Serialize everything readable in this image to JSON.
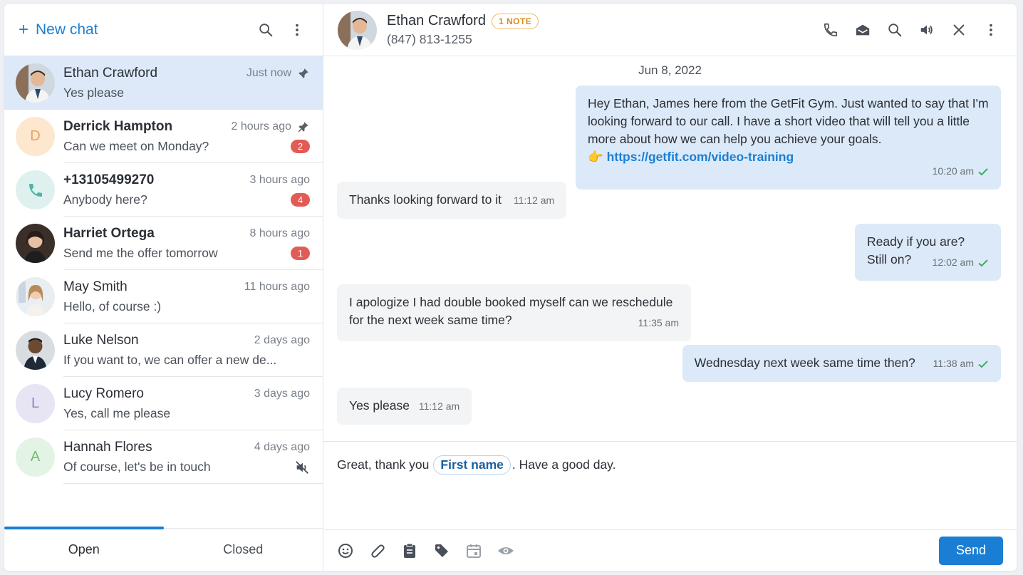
{
  "sidebar": {
    "new_chat_label": "New chat",
    "chats": [
      {
        "name": "Ethan Crawford",
        "time": "Just now",
        "preview": "Yes please",
        "pinned": true,
        "unread": "",
        "avatar": "photo-man-1",
        "bold": false
      },
      {
        "name": "Derrick Hampton",
        "time": "2 hours ago",
        "preview": "Can we meet on Monday?",
        "pinned": true,
        "unread": "2",
        "avatar_initial": "D",
        "bold": true
      },
      {
        "name": "+13105499270",
        "time": "3 hours ago",
        "preview": "Anybody here?",
        "pinned": false,
        "unread": "4",
        "avatar": "phone-icon",
        "bold": true
      },
      {
        "name": "Harriet Ortega",
        "time": "8 hours ago",
        "preview": "Send me the offer tomorrow",
        "pinned": false,
        "unread": "1",
        "avatar": "photo-woman-1",
        "bold": true
      },
      {
        "name": "May Smith",
        "time": "11 hours ago",
        "preview": "Hello, of course :)",
        "pinned": false,
        "unread": "",
        "avatar": "photo-woman-2",
        "bold": false
      },
      {
        "name": "Luke Nelson",
        "time": "2 days ago",
        "preview": "If you want to, we can offer a new de...",
        "pinned": false,
        "unread": "",
        "avatar": "photo-man-2",
        "bold": false
      },
      {
        "name": "Lucy Romero",
        "time": "3 days ago",
        "preview": "Yes, call me please",
        "pinned": false,
        "unread": "",
        "avatar_initial": "L",
        "bold": false
      },
      {
        "name": "Hannah Flores",
        "time": "4 days ago",
        "preview": "Of course, let's be in touch",
        "pinned": false,
        "unread": "",
        "avatar_initial": "A",
        "muted": true,
        "bold": false
      }
    ],
    "tabs": {
      "open": "Open",
      "closed": "Closed"
    }
  },
  "header": {
    "name": "Ethan Crawford",
    "note_badge": "1 NOTE",
    "phone": "(847) 813-1255"
  },
  "conversation": {
    "date": "Jun 8, 2022",
    "messages": [
      {
        "direction": "out",
        "text": "Hey Ethan, James here from the GetFit Gym. Just wanted to say that I'm looking forward to our call. I have a short video that will tell you a little more about how we can help you achieve your goals.",
        "link": "https://getfit.com/video-training",
        "link_emoji": "👉",
        "time": "10:20 am"
      },
      {
        "direction": "in",
        "text": "Thanks looking forward to it",
        "time": "11:12 am"
      },
      {
        "direction": "out",
        "text_line1": "Ready if you are?",
        "text_line2": "Still on?",
        "time": "12:02 am"
      },
      {
        "direction": "in",
        "text_line1": "I apologize I had double booked myself can we reschedule",
        "text_line2": "for the next week same time?",
        "time": "11:35 am"
      },
      {
        "direction": "out",
        "text": "Wednesday next week same time then?",
        "time": "11:38 am"
      },
      {
        "direction": "in",
        "text": "Yes please",
        "time": "11:12 am"
      }
    ]
  },
  "composer": {
    "text_before": "Great, thank you",
    "token": "First name",
    "text_after": ". Have a good day.",
    "send_label": "Send"
  },
  "colors": {
    "accent": "#1a7fd4",
    "badge": "#e25c57",
    "active_row": "#dde9f8",
    "outgoing_bubble": "#dce9f8",
    "incoming_bubble": "#f3f4f6",
    "note_badge": "#f0b765"
  }
}
